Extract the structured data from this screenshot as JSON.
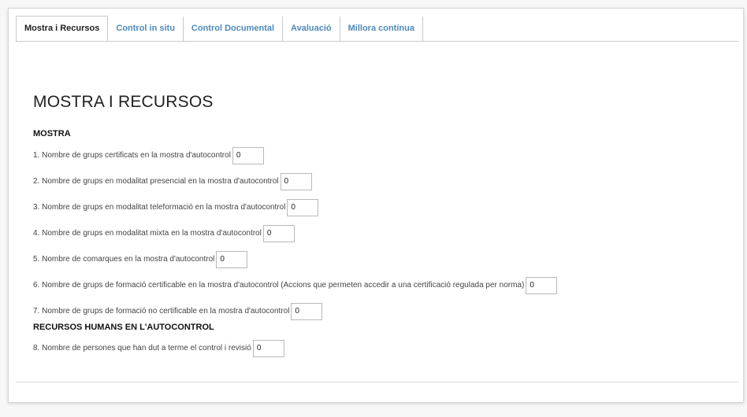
{
  "tabs": [
    {
      "label": "Mostra i Recursos",
      "active": true
    },
    {
      "label": "Control in situ",
      "active": false
    },
    {
      "label": "Control Documental",
      "active": false
    },
    {
      "label": "Avaluació",
      "active": false
    },
    {
      "label": "Millora contínua",
      "active": false
    }
  ],
  "page": {
    "title": "MOSTRA I RECURSOS"
  },
  "sections": {
    "mostra": {
      "heading": "MOSTRA"
    },
    "recursos": {
      "heading": "RECURSOS HUMANS EN L'AUTOCONTROL"
    }
  },
  "fields": [
    {
      "label": "1. Nombre de grups certificats en la mostra d'autocontrol",
      "value": "0"
    },
    {
      "label": "2. Nombre de grups en modalitat presencial en la mostra d'autocontrol",
      "value": "0"
    },
    {
      "label": "3. Nombre de grups en modalitat teleformació en la mostra d'autocontrol",
      "value": "0"
    },
    {
      "label": "4. Nombre de grups en modalitat mixta en la mostra d'autocontrol",
      "value": "0"
    },
    {
      "label": "5. Nombre de comarques en la mostra d'autocontrol",
      "value": "0"
    },
    {
      "label": "6. Nombre de grups de formació certificable en la mostra d'autocontrol (Accions que permeten accedir a una certificació regulada per norma)",
      "value": "0"
    },
    {
      "label": "7. Nombre de grups de formació no certificable en la mostra d'autocontrol",
      "value": "0"
    },
    {
      "label": "8. Nombre de persones que han dut a terme el control i revisió",
      "value": "0"
    }
  ]
}
